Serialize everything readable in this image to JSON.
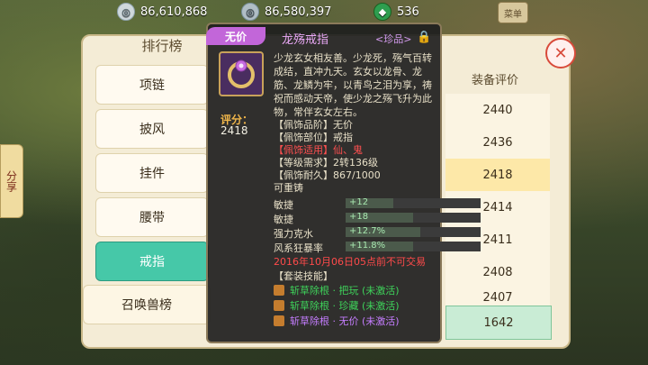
{
  "topbar": {
    "silver": "86,610,868",
    "bound_silver": "86,580,397",
    "jade": "536",
    "menu_label": "菜单"
  },
  "panel": {
    "title": "排行榜",
    "categories": [
      "项链",
      "披风",
      "挂件",
      "腰带",
      "戒指"
    ],
    "active_category": "戒指",
    "sub_category": "召唤兽榜",
    "side_tab": "分享",
    "score_header": "装备评价",
    "scores": [
      "2440",
      "2436",
      "2418",
      "2414",
      "2411",
      "2408",
      "2407"
    ],
    "my_score": "1642"
  },
  "tooltip": {
    "badge": "无价",
    "name": "龙殇戒指",
    "grade": "<珍品>",
    "score_label": "评分：",
    "score_value": "2418",
    "description": "少龙玄女相友善。少龙死，殇气百转成结，直冲九天。玄女以龙骨、龙筋、龙鳞为牢，以青鸟之泪为享，祷祝而感动天帝，使少龙之殇飞升为此物，常伴玄女左右。",
    "attrs": [
      "【佩饰品阶】无价",
      "【佩饰部位】戒指",
      "【佩饰适用】仙、鬼",
      "【等级需求】2转136级",
      "【佩饰耐久】867/1000",
      "可重铸"
    ],
    "bars": [
      {
        "label": "敏捷",
        "text": "+12",
        "fill": 0.35
      },
      {
        "label": "敏捷",
        "text": "+18",
        "fill": 0.5
      },
      {
        "label": "强力克水",
        "text": "+12.7%",
        "fill": 0.55
      },
      {
        "label": "风系狂暴率",
        "text": "+11.8%",
        "fill": 0.5
      }
    ],
    "trade_note": "2016年10月06日05点前不可交易",
    "skills_header": "【套装技能】",
    "skills": [
      {
        "name": "斩草除根 · 把玩 (未激活)"
      },
      {
        "name": "斩草除根 · 珍藏 (未激活)"
      },
      {
        "name": "斩草除根 · 无价 (未激活)"
      }
    ]
  }
}
